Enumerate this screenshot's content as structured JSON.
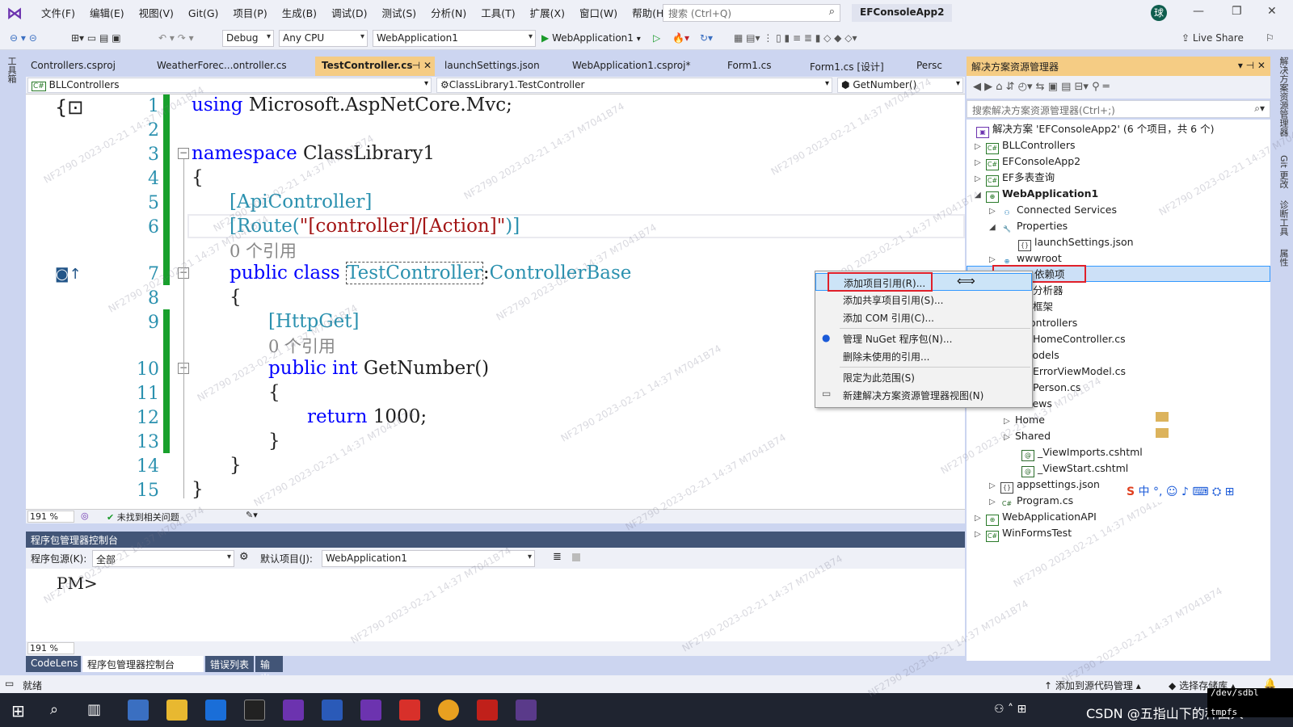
{
  "menubar": {
    "items": [
      "文件(F)",
      "编辑(E)",
      "视图(V)",
      "Git(G)",
      "项目(P)",
      "生成(B)",
      "调试(D)",
      "测试(S)",
      "分析(N)",
      "工具(T)",
      "扩展(X)",
      "窗口(W)",
      "帮助(H)"
    ],
    "search_placeholder": "搜索 (Ctrl+Q)",
    "solution_title": "EFConsoleApp2",
    "avatar": "球"
  },
  "toolbar": {
    "config": "Debug",
    "platform": "Any CPU",
    "startup": "WebApplication1",
    "run_label": "WebApplication1",
    "live_share": "Live Share"
  },
  "left_tools_label": "工具箱",
  "doc_tabs": [
    "Controllers.csproj",
    "WeatherForec...ontroller.cs",
    "TestController.cs",
    "launchSettings.json",
    "WebApplication1.csproj*",
    "Form1.cs",
    "Form1.cs [设计]",
    "Persc"
  ],
  "nav": {
    "project": "BLLControllers",
    "class": "ClassLibrary1.TestController",
    "member": "GetNumber()"
  },
  "code": {
    "line_numbers": [
      "1",
      "2",
      "3",
      "4",
      "5",
      "6",
      "7",
      "8",
      "9",
      "10",
      "11",
      "12",
      "13",
      "14",
      "15"
    ],
    "l1_kw": "using",
    "l1_rest": " Microsoft.AspNetCore.Mvc;",
    "l3_kw": "namespace",
    "l3_rest": " ClassLibrary1",
    "l4": "{",
    "l5": "[ApiController]",
    "l6_a": "[Route(",
    "l6_str": "\"[controller]/[Action]\"",
    "l6_b": ")]",
    "ref1": "0 个引用",
    "l7_kw": "public class",
    "l7_name": "TestController",
    "l7_colon": ":",
    "l7_base": "ControllerBase",
    "l8": "{",
    "l9": "[HttpGet]",
    "ref2": "0 个引用",
    "l10_kw": "public int",
    "l10_rest": " GetNumber()",
    "l11": "{",
    "l12_kw": "return",
    "l12_rest": " 1000;",
    "l13": "}",
    "l14": "}",
    "l15": "}"
  },
  "editor_status": {
    "zoom": "191 %",
    "issues": "未找到相关问题"
  },
  "pmc": {
    "title": "程序包管理器控制台",
    "source_label": "程序包源(K):",
    "source_value": "全部",
    "default_label": "默认项目(J):",
    "default_value": "WebApplication1",
    "prompt": "PM>",
    "zoom": "191 %"
  },
  "bottom_tabs": [
    "CodeLens",
    "程序包管理器控制台",
    "错误列表",
    "输出"
  ],
  "solution": {
    "title": "解决方案资源管理器",
    "search_placeholder": "搜索解决方案资源管理器(Ctrl+;)",
    "nodes": [
      {
        "label": "解决方案 'EFConsoleApp2' (6 个项目，共 6 个)"
      },
      {
        "label": "BLLControllers"
      },
      {
        "label": "EFConsoleApp2"
      },
      {
        "label": "EF多表查询"
      },
      {
        "label": "WebApplication1"
      },
      {
        "label": "Connected Services"
      },
      {
        "label": "Properties"
      },
      {
        "label": "launchSettings.json"
      },
      {
        "label": "wwwroot"
      },
      {
        "label": "依赖项"
      },
      {
        "label": "分析器"
      },
      {
        "label": "框架"
      },
      {
        "label": "ontrollers"
      },
      {
        "label": "HomeController.cs"
      },
      {
        "label": "lodels"
      },
      {
        "label": "ErrorViewModel.cs"
      },
      {
        "label": "Person.cs"
      },
      {
        "label": "iews"
      },
      {
        "label": "Home"
      },
      {
        "label": "Shared"
      },
      {
        "label": "_ViewImports.cshtml"
      },
      {
        "label": "_ViewStart.cshtml"
      },
      {
        "label": "appsettings.json"
      },
      {
        "label": "Program.cs"
      },
      {
        "label": "WebApplicationAPI"
      },
      {
        "label": "WinFormsTest"
      }
    ]
  },
  "context_menu": [
    "添加项目引用(R)...",
    "添加共享项目引用(S)...",
    "添加 COM 引用(C)...",
    "管理 NuGet 程序包(N)...",
    "删除未使用的引用...",
    "限定为此范围(S)",
    "新建解决方案资源管理器视图(N)"
  ],
  "right_tools": [
    "解决方案资源管理器",
    "Git 更改",
    "诊断工具",
    "属性"
  ],
  "statusbar": {
    "ready": "就绪",
    "source_control": "添加到源代码管理",
    "repo": "选择存储库"
  },
  "ime": {
    "lang": "中"
  },
  "watermark": "NF2790 2023-02-21 14:37 M7041B74",
  "taskbar_text": "CSDN @五指山下的种田人",
  "overlay": {
    "line1": "/dev/sdbl",
    "line2": "tmpfs"
  }
}
